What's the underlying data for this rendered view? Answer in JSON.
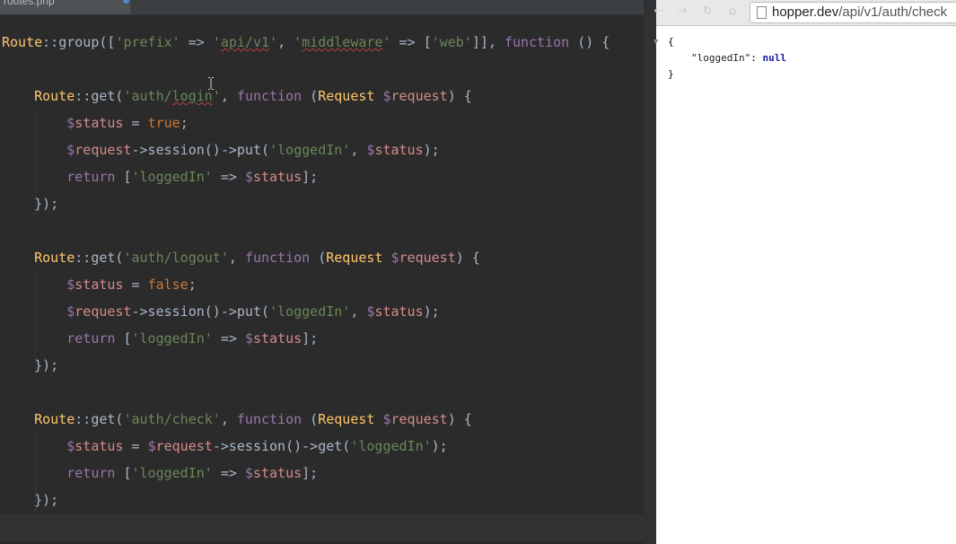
{
  "editor": {
    "tab_label": "routes.php",
    "lines": [
      [
        [
          "c",
          "Route"
        ],
        [
          "p",
          "::group(["
        ],
        [
          "s",
          "'prefix'"
        ],
        [
          "p",
          " => "
        ],
        [
          "s",
          "'"
        ],
        [
          "s sq",
          "api/v1"
        ],
        [
          "s",
          "'"
        ],
        [
          "p",
          ", "
        ],
        [
          "s",
          "'"
        ],
        [
          "s sq",
          "middleware"
        ],
        [
          "s",
          "'"
        ],
        [
          "p",
          " => ["
        ],
        [
          "s",
          "'web'"
        ],
        [
          "p",
          "]], "
        ],
        [
          "fn",
          "function"
        ],
        [
          "p",
          " () {"
        ]
      ],
      [],
      [
        [
          "p",
          "    "
        ],
        [
          "c",
          "Route"
        ],
        [
          "p",
          "::get("
        ],
        [
          "s",
          "'auth/"
        ],
        [
          "s sq",
          "login"
        ],
        [
          "s",
          "'"
        ],
        [
          "p",
          ", "
        ],
        [
          "fn",
          "function"
        ],
        [
          "p",
          " ("
        ],
        [
          "c",
          "Request"
        ],
        [
          "p",
          " "
        ],
        [
          "v",
          "$"
        ],
        [
          "v2",
          "request"
        ],
        [
          "p",
          ") {"
        ]
      ],
      [
        [
          "p",
          "        "
        ],
        [
          "v",
          "$"
        ],
        [
          "v2",
          "status"
        ],
        [
          "p",
          " = "
        ],
        [
          "k",
          "true"
        ],
        [
          "p",
          ";"
        ]
      ],
      [
        [
          "p",
          "        "
        ],
        [
          "v",
          "$"
        ],
        [
          "v2",
          "request"
        ],
        [
          "p",
          "->session()->put("
        ],
        [
          "s",
          "'loggedIn'"
        ],
        [
          "p",
          ", "
        ],
        [
          "v",
          "$"
        ],
        [
          "v2",
          "status"
        ],
        [
          "p",
          ");"
        ]
      ],
      [
        [
          "p",
          "        "
        ],
        [
          "fn",
          "return"
        ],
        [
          "p",
          " ["
        ],
        [
          "s",
          "'loggedIn'"
        ],
        [
          "p",
          " => "
        ],
        [
          "v",
          "$"
        ],
        [
          "v2",
          "status"
        ],
        [
          "p",
          "];"
        ]
      ],
      [
        [
          "p",
          "    });"
        ]
      ],
      [],
      [
        [
          "p",
          "    "
        ],
        [
          "c",
          "Route"
        ],
        [
          "p",
          "::get("
        ],
        [
          "s",
          "'auth/logout'"
        ],
        [
          "p",
          ", "
        ],
        [
          "fn",
          "function"
        ],
        [
          "p",
          " ("
        ],
        [
          "c",
          "Request"
        ],
        [
          "p",
          " "
        ],
        [
          "v",
          "$"
        ],
        [
          "v2",
          "request"
        ],
        [
          "p",
          ") {"
        ]
      ],
      [
        [
          "p",
          "        "
        ],
        [
          "v",
          "$"
        ],
        [
          "v2",
          "status"
        ],
        [
          "p",
          " = "
        ],
        [
          "k",
          "false"
        ],
        [
          "p",
          ";"
        ]
      ],
      [
        [
          "p",
          "        "
        ],
        [
          "v",
          "$"
        ],
        [
          "v2",
          "request"
        ],
        [
          "p",
          "->session()->put("
        ],
        [
          "s",
          "'loggedIn'"
        ],
        [
          "p",
          ", "
        ],
        [
          "v",
          "$"
        ],
        [
          "v2",
          "status"
        ],
        [
          "p",
          ");"
        ]
      ],
      [
        [
          "p",
          "        "
        ],
        [
          "fn",
          "return"
        ],
        [
          "p",
          " ["
        ],
        [
          "s",
          "'loggedIn'"
        ],
        [
          "p",
          " => "
        ],
        [
          "v",
          "$"
        ],
        [
          "v2",
          "status"
        ],
        [
          "p",
          "];"
        ]
      ],
      [
        [
          "p",
          "    });"
        ]
      ],
      [],
      [
        [
          "p",
          "    "
        ],
        [
          "c",
          "Route"
        ],
        [
          "p",
          "::get("
        ],
        [
          "s",
          "'auth/check'"
        ],
        [
          "p",
          ", "
        ],
        [
          "fn",
          "function"
        ],
        [
          "p",
          " ("
        ],
        [
          "c",
          "Request"
        ],
        [
          "p",
          " "
        ],
        [
          "v",
          "$"
        ],
        [
          "v2",
          "request"
        ],
        [
          "p",
          ") {"
        ]
      ],
      [
        [
          "p",
          "        "
        ],
        [
          "v",
          "$"
        ],
        [
          "v2",
          "status"
        ],
        [
          "p",
          " = "
        ],
        [
          "v",
          "$"
        ],
        [
          "v2",
          "request"
        ],
        [
          "p",
          "->session()->get("
        ],
        [
          "s",
          "'loggedIn'"
        ],
        [
          "p",
          ");"
        ]
      ],
      [
        [
          "p",
          "        "
        ],
        [
          "fn",
          "return"
        ],
        [
          "p",
          " ["
        ],
        [
          "s",
          "'loggedIn'"
        ],
        [
          "p",
          " => "
        ],
        [
          "v",
          "$"
        ],
        [
          "v2",
          "status"
        ],
        [
          "p",
          "];"
        ]
      ],
      [
        [
          "p",
          "    });"
        ]
      ],
      [],
      [
        [
          "p",
          "});"
        ]
      ]
    ]
  },
  "browser": {
    "url_host": "hopper.dev",
    "url_path": "/api/v1/auth/check",
    "json_open": "{",
    "json_key": "\"loggedIn\"",
    "json_colon": ": ",
    "json_value": "null",
    "json_close": "}"
  },
  "colors": {
    "editor_bg": "#2b2b2b",
    "class_name": "#ffc66d",
    "string": "#6a8759",
    "keyword": "#cc7832",
    "function_keyword": "#9876aa",
    "variable": "#d78a8a"
  }
}
